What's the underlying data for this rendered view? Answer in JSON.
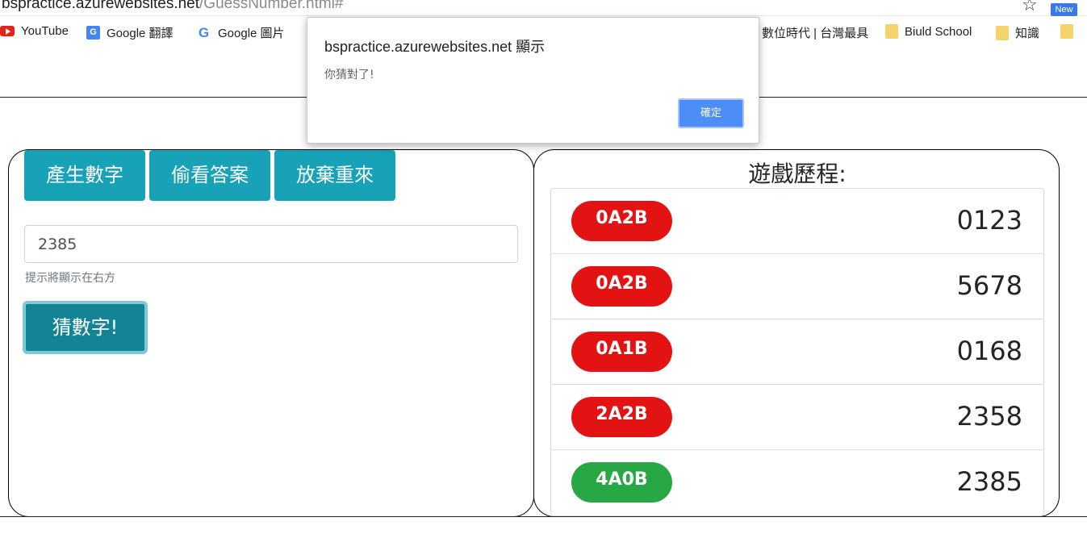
{
  "browser": {
    "url_host": "bspractice.azurewebsites.net",
    "url_path": "/GuessNumber.html#",
    "star_icon": "star-icon",
    "new_badge": "New",
    "bookmarks": [
      {
        "label": "YouTube",
        "icon": "youtube-icon"
      },
      {
        "label": "Google 翻譯",
        "icon": "google-translate-icon"
      },
      {
        "label": "Google 圖片",
        "icon": "google-icon"
      },
      {
        "label": "數位時代 | 台灣最具",
        "icon": ""
      },
      {
        "label": "Biuld School",
        "icon": "folder-icon"
      },
      {
        "label": "知識",
        "icon": "folder-icon"
      }
    ]
  },
  "dialog": {
    "title": "bspractice.azurewebsites.net 顯示",
    "message": "你猜對了!",
    "ok_label": "確定"
  },
  "left_panel": {
    "generate_label": "產生數字",
    "peek_label": "偷看答案",
    "restart_label": "放棄重來",
    "input_value": "2385",
    "hint": "提示將顯示在右方",
    "guess_label": "猜數字!"
  },
  "right_panel": {
    "title": "遊戲歷程:",
    "history": [
      {
        "result": "0A2B",
        "guess": "0123",
        "color": "#e31313"
      },
      {
        "result": "0A2B",
        "guess": "5678",
        "color": "#e31313"
      },
      {
        "result": "0A1B",
        "guess": "0168",
        "color": "#e31313"
      },
      {
        "result": "2A2B",
        "guess": "2358",
        "color": "#e31313"
      },
      {
        "result": "4A0B",
        "guess": "2385",
        "color": "#28a745"
      }
    ]
  }
}
